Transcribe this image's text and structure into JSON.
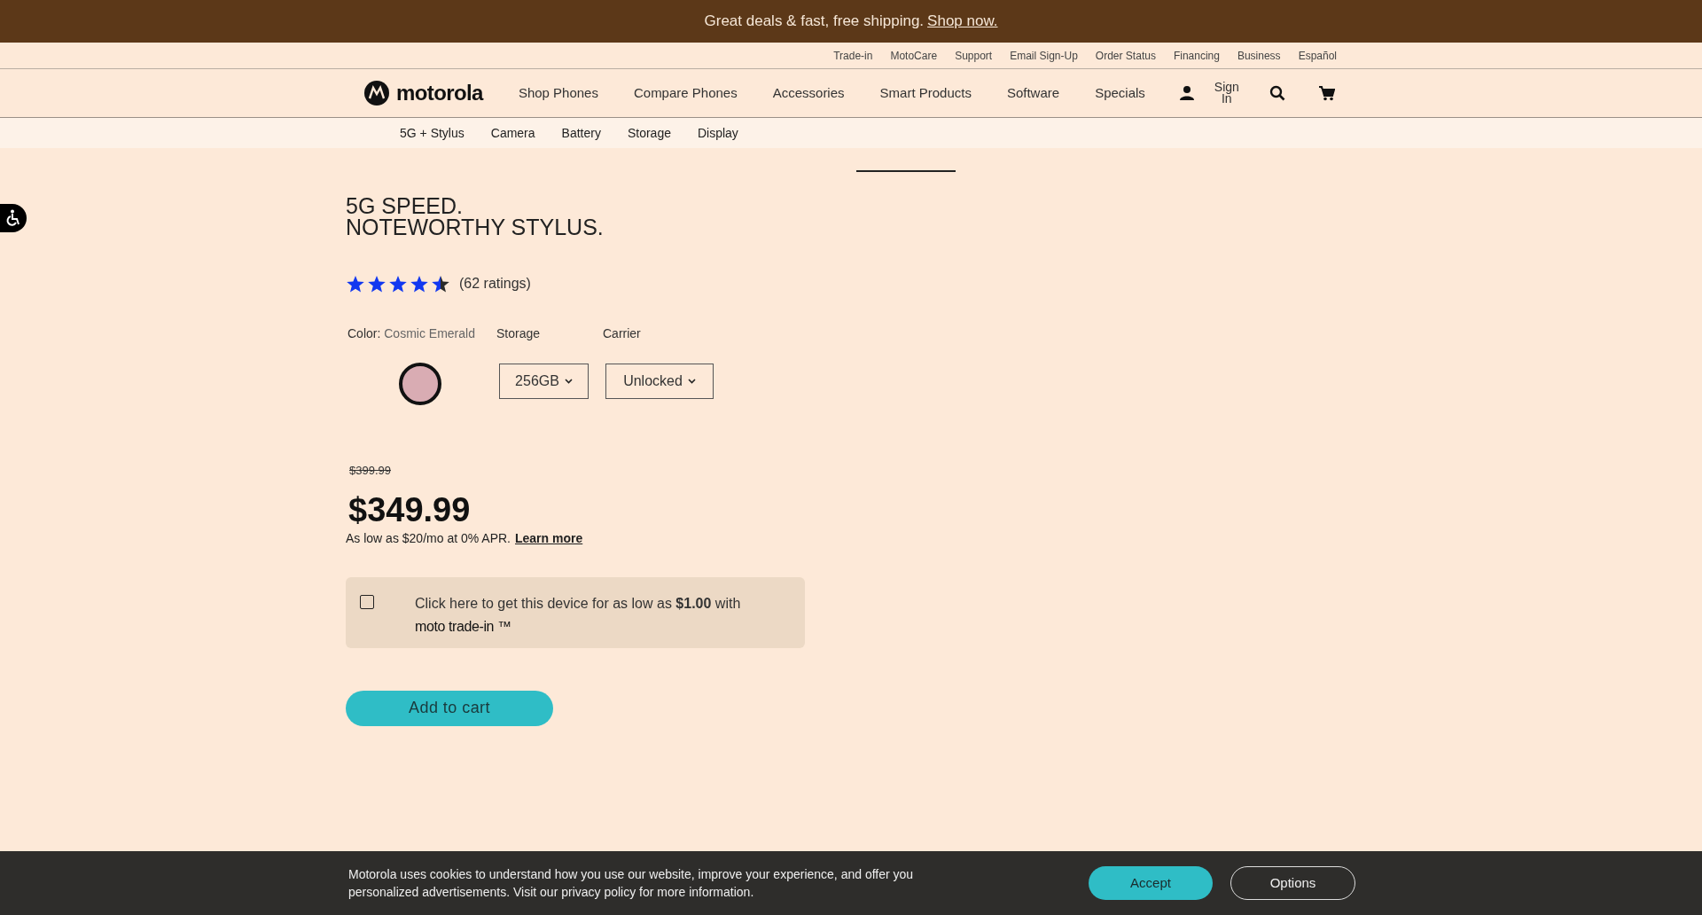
{
  "promo": {
    "text": "Great deals & fast, free shipping.",
    "link": "Shop now."
  },
  "utility_links": [
    "Trade-in",
    "MotoCare",
    "Support",
    "Email Sign-Up",
    "Order Status",
    "Financing",
    "Business",
    "Español"
  ],
  "nav": {
    "logo": "motorola",
    "items": [
      "Shop Phones",
      "Compare Phones",
      "Accessories",
      "Smart Products",
      "Software",
      "Specials"
    ],
    "sign_in": "Sign In"
  },
  "subnav": [
    "5G + Stylus",
    "Camera",
    "Battery",
    "Storage",
    "Display"
  ],
  "product": {
    "title_lines": [
      "5G SPEED.",
      "NOTEWORTHY STYLUS."
    ],
    "stars": 4.5,
    "ratings": "(62 ratings)",
    "color_label": "Color:",
    "color_value": "Cosmic Emerald",
    "swatches": [
      {
        "color": "#d9acb3",
        "selected": true
      }
    ],
    "storage_label": "Storage",
    "storage_value": "256GB",
    "carrier_label": "Carrier",
    "carrier_value": "Unlocked",
    "old_price": "$399.99",
    "price": "$349.99",
    "financing": "As low as $20/mo at 0% APR.",
    "financing_link": "Learn more",
    "trade_in": {
      "checked": false,
      "text": "Click here to get this device for as low as **$1.00** with",
      "brand": "moto trade-in ™"
    },
    "add_to_cart": "Add to cart"
  },
  "cookie_banner": {
    "text": "Motorola uses cookies to understand how you use our website, improve your experience, and offer you personalized advertisements. Visit our privacy policy for more information.",
    "accept": "Accept",
    "options": "Options"
  }
}
